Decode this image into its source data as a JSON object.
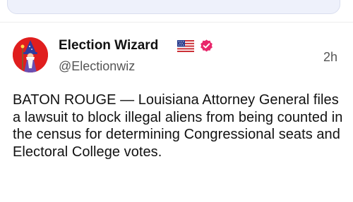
{
  "post": {
    "display_name": "Election Wizard",
    "handle": "@Electionwiz",
    "timestamp": "2h",
    "text": "BATON ROUGE — Louisiana Attorney General files a lawsuit to block illegal aliens from being counted in the census for determining Congressional seats and Electoral College votes.",
    "flag_icon": "us-flag-icon",
    "verified_icon": "verified-badge-icon",
    "avatar_icon": "wizard-avatar-icon"
  },
  "colors": {
    "avatar_bg": "#e01e1e",
    "verified_badge": "#e8266b",
    "prev_card_bg": "#eef1fb"
  }
}
